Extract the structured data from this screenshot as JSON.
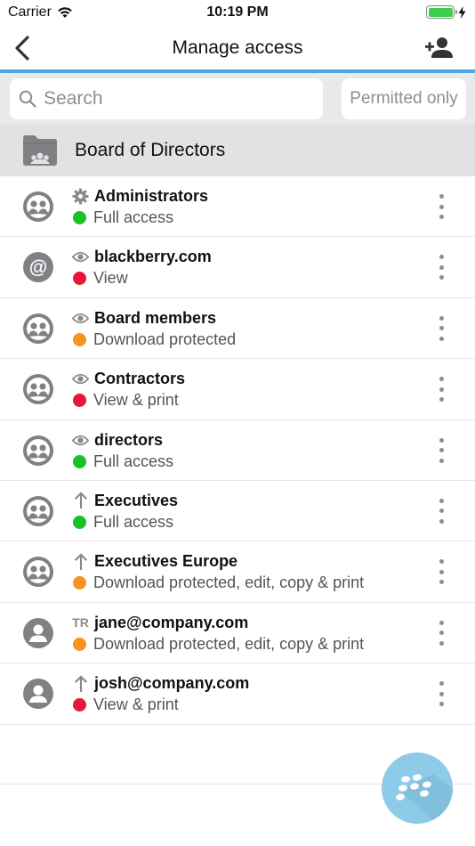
{
  "status_bar": {
    "carrier": "Carrier",
    "time": "10:19 PM",
    "battery_color": "#3ccf4e"
  },
  "nav": {
    "title": "Manage access",
    "back_icon": "chevron-left-icon",
    "add_icon": "add-user-icon",
    "accent_color": "#4aa8dc"
  },
  "search": {
    "placeholder": "Search",
    "filter_label": "Permitted only"
  },
  "folder": {
    "name": "Board of Directors"
  },
  "colors": {
    "green": "#19c22a",
    "red": "#e5173a",
    "orange": "#f7931e"
  },
  "entries": [
    {
      "avatar": "group",
      "type_icon": "gear-icon",
      "name": "Administrators",
      "status": "green",
      "access": "Full access"
    },
    {
      "avatar": "domain",
      "type_icon": "eye-icon",
      "name": "blackberry.com",
      "status": "red",
      "access": "View"
    },
    {
      "avatar": "group",
      "type_icon": "eye-icon",
      "name": "Board members",
      "status": "orange",
      "access": "Download protected"
    },
    {
      "avatar": "group",
      "type_icon": "eye-icon",
      "name": "Contractors",
      "status": "red",
      "access": "View & print"
    },
    {
      "avatar": "group",
      "type_icon": "eye-icon",
      "name": "directors",
      "status": "green",
      "access": "Full access"
    },
    {
      "avatar": "group",
      "type_icon": "arrow-up-icon",
      "name": "Executives",
      "status": "green",
      "access": "Full access"
    },
    {
      "avatar": "group",
      "type_icon": "arrow-up-icon",
      "name": "Executives Europe",
      "status": "orange",
      "access": "Download protected, edit, copy & print"
    },
    {
      "avatar": "person",
      "type_icon": "tr-badge",
      "type_text": "TR",
      "name": "jane@company.com",
      "status": "orange",
      "access": "Download protected, edit, copy & print"
    },
    {
      "avatar": "person",
      "type_icon": "arrow-up-icon",
      "name": "josh@company.com",
      "status": "red",
      "access": "View & print"
    }
  ]
}
